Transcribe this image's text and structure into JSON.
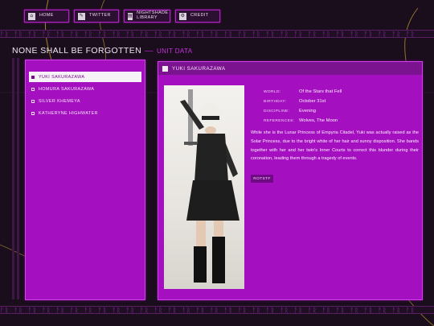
{
  "nav": {
    "items": [
      {
        "label": "HOME",
        "icon": "home-icon",
        "glyph": "⌂"
      },
      {
        "label": "TWITTER",
        "icon": "twitter-icon",
        "glyph": "✎"
      },
      {
        "label": "NIGHTSHADE LIBRARY",
        "icon": "library-icon",
        "glyph": "▤"
      },
      {
        "label": "CREDIT",
        "icon": "credit-icon",
        "glyph": "⚙"
      }
    ]
  },
  "strip_text": "ᚨᚱ ᚨᚱ ᚨᚱ ᚨᚱ ᚨᚱ ᚨᚱ ᚨᚱ ᚨᚱ ᚨᚱ ᚨᚱ ᚨᚱ ᚨᚱ ᚨᚱ ᚨᚱ ᚨᚱ ᚨᚱ ᚨᚱ ᚨᚱ ᚨᚱ ᚨᚱ ᚨᚱ ᚨᚱ ᚨᚱ ᚨᚱ ᚨᚱ ᚨᚱ ᚨᚱ ᚨᚱ ᚨᚱ ᚨᚱ",
  "heading": {
    "title": "NONE SHALL BE FORGOTTEN",
    "dash": "—",
    "subtitle": "UNIT DATA"
  },
  "characters": [
    {
      "name": "YUKI SAKURAZAWA",
      "active": true
    },
    {
      "name": "HOMURA SAKURAZAWA",
      "active": false
    },
    {
      "name": "SILVER KHEMEYA",
      "active": false
    },
    {
      "name": "KATHERYNE HIGHWATER",
      "active": false
    }
  ],
  "profile": {
    "name": "YUKI SAKURAZAWA",
    "fields": [
      {
        "key": "WORLD:",
        "value": "Of the Stars that Fell"
      },
      {
        "key": "BIRTHDAY:",
        "value": "October 31st"
      },
      {
        "key": "DISCIPLINE:",
        "value": "Evening"
      },
      {
        "key": "REFERENCES:",
        "value": "Wolves, The Moon"
      }
    ],
    "bio": "While she is the Lunar Princess of Empyria Citadel, Yuki was actually raised as the Solar Princess, due to the bright white of her hair and sunny disposition. She bands together with her and her twin's Inner Courts to correct this blunder during their coronation, leading them through a tragedy of events.",
    "tag": "ROTSTF"
  },
  "colors": {
    "accent": "#a40fc0",
    "border": "#d343ea",
    "background": "#1a0d1c",
    "lines": "#c9a334"
  }
}
